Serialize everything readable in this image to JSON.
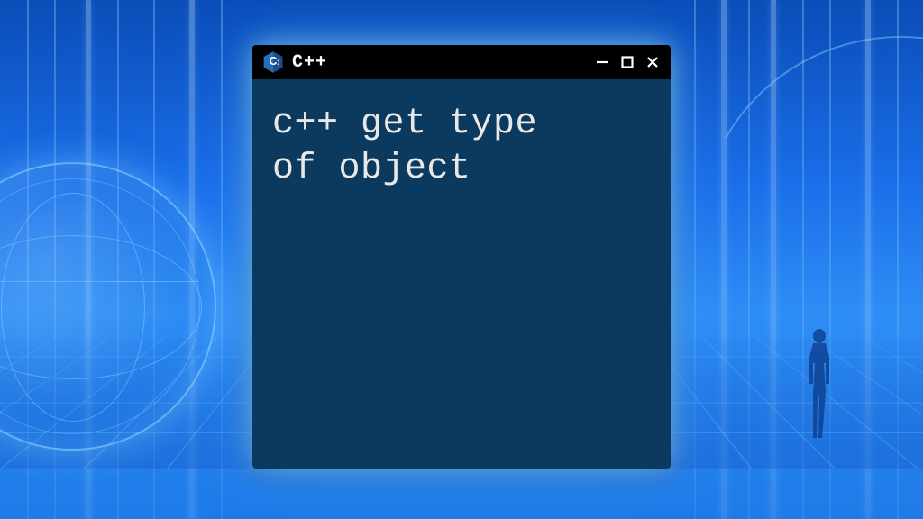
{
  "titlebar": {
    "title": "C++",
    "logo_label": "cpp-logo"
  },
  "window": {
    "body_text": "c++ get type\nof object"
  },
  "colors": {
    "window_body": "#0b3a5e",
    "titlebar_bg": "#000000",
    "text": "#e8e8e8"
  }
}
